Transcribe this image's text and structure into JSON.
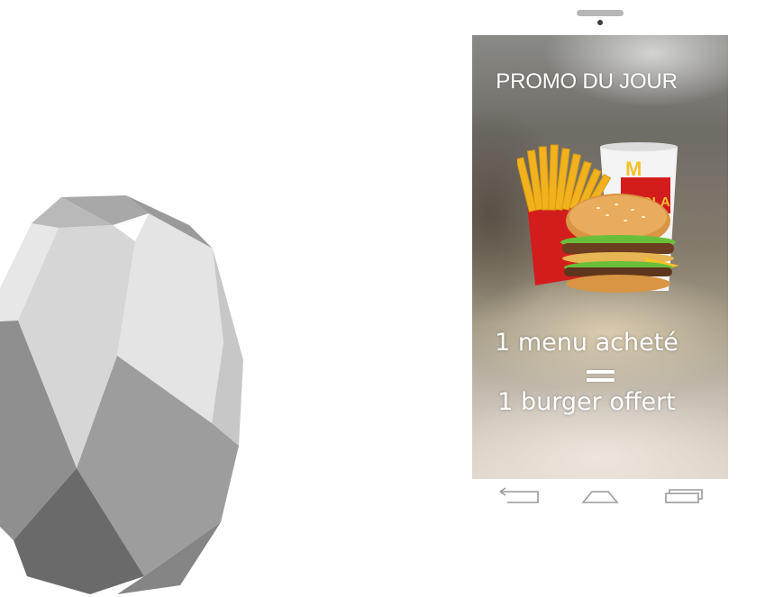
{
  "promo": {
    "title": "PROMO DU JOUR",
    "line1": "1 menu acheté",
    "line2": "1 burger offert",
    "brand_mark": "M",
    "cup_text": "SOLA"
  },
  "colors": {
    "beacon_light": "#e6e6e6",
    "beacon_mid": "#a8a8a8",
    "beacon_dark": "#666666",
    "nav_gray": "#a0a0a0",
    "text_white": "#ffffff",
    "mcd_red": "#d31d1d",
    "mcd_yellow": "#f5c12b"
  },
  "icons": [
    "beacon-icon",
    "back-icon",
    "home-icon",
    "recent-apps-icon"
  ]
}
